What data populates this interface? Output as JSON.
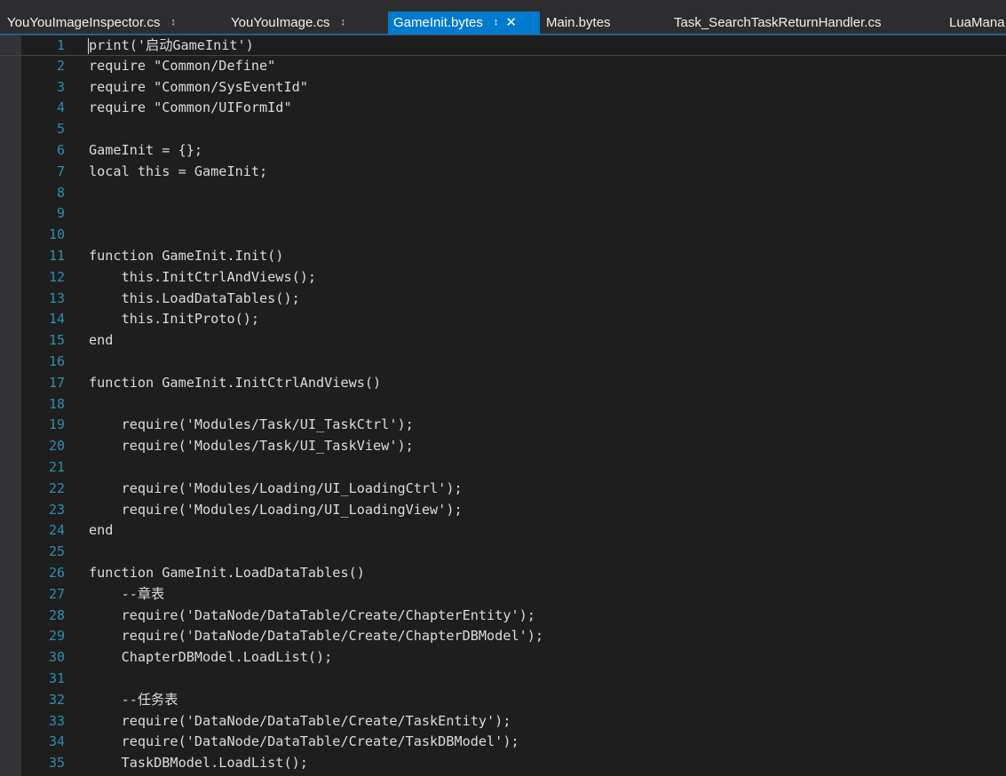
{
  "tabs": [
    {
      "label": "YouYouImageInspector.cs",
      "pin": "↕"
    },
    {
      "label": "YouYouImage.cs",
      "pin": "↕"
    },
    {
      "label": "GameInit.bytes",
      "pin": "↕",
      "close": "✕"
    },
    {
      "label": "Main.bytes"
    },
    {
      "label": "Task_SearchTaskReturnHandler.cs"
    },
    {
      "label": "LuaMana"
    }
  ],
  "active_tab": 2,
  "editor": {
    "lines": [
      {
        "num": "1",
        "code": "print('启动GameInit')"
      },
      {
        "num": "2",
        "code": "require \"Common/Define\""
      },
      {
        "num": "3",
        "code": "require \"Common/SysEventId\""
      },
      {
        "num": "4",
        "code": "require \"Common/UIFormId\""
      },
      {
        "num": "5",
        "code": ""
      },
      {
        "num": "6",
        "code": "GameInit = {};"
      },
      {
        "num": "7",
        "code": "local this = GameInit;"
      },
      {
        "num": "8",
        "code": ""
      },
      {
        "num": "9",
        "code": ""
      },
      {
        "num": "10",
        "code": ""
      },
      {
        "num": "11",
        "code": "function GameInit.Init()"
      },
      {
        "num": "12",
        "code": "    this.InitCtrlAndViews();"
      },
      {
        "num": "13",
        "code": "    this.LoadDataTables();"
      },
      {
        "num": "14",
        "code": "    this.InitProto();"
      },
      {
        "num": "15",
        "code": "end"
      },
      {
        "num": "16",
        "code": ""
      },
      {
        "num": "17",
        "code": "function GameInit.InitCtrlAndViews()"
      },
      {
        "num": "18",
        "code": ""
      },
      {
        "num": "19",
        "code": "    require('Modules/Task/UI_TaskCtrl');"
      },
      {
        "num": "20",
        "code": "    require('Modules/Task/UI_TaskView');"
      },
      {
        "num": "21",
        "code": ""
      },
      {
        "num": "22",
        "code": "    require('Modules/Loading/UI_LoadingCtrl');"
      },
      {
        "num": "23",
        "code": "    require('Modules/Loading/UI_LoadingView');"
      },
      {
        "num": "24",
        "code": "end"
      },
      {
        "num": "25",
        "code": ""
      },
      {
        "num": "26",
        "code": "function GameInit.LoadDataTables()"
      },
      {
        "num": "27",
        "code": "    --章表"
      },
      {
        "num": "28",
        "code": "    require('DataNode/DataTable/Create/ChapterEntity');"
      },
      {
        "num": "29",
        "code": "    require('DataNode/DataTable/Create/ChapterDBModel');"
      },
      {
        "num": "30",
        "code": "    ChapterDBModel.LoadList();"
      },
      {
        "num": "31",
        "code": ""
      },
      {
        "num": "32",
        "code": "    --任务表"
      },
      {
        "num": "33",
        "code": "    require('DataNode/DataTable/Create/TaskEntity');"
      },
      {
        "num": "34",
        "code": "    require('DataNode/DataTable/Create/TaskDBModel');"
      },
      {
        "num": "35",
        "code": "    TaskDBModel.LoadList();"
      }
    ]
  },
  "colors": {
    "editor_bg": "#1e1e1e",
    "tab_bg": "#2d2d30",
    "active_tab": "#007acc",
    "line_number": "#2b91af",
    "code_text": "#dcdcdc"
  }
}
